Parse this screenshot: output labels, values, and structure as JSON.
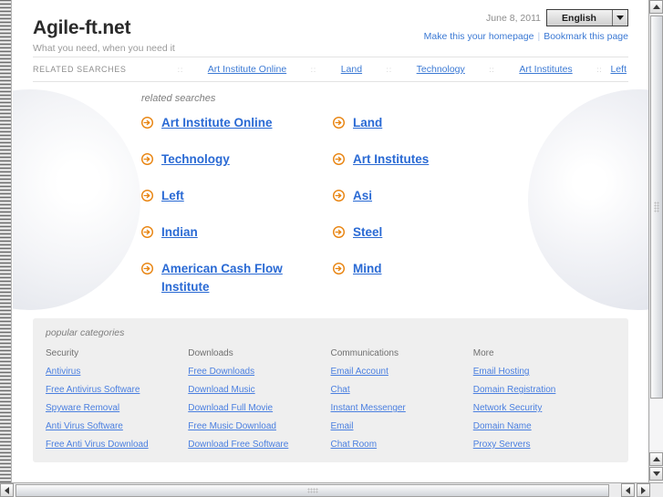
{
  "header": {
    "site_title": "Agile-ft.net",
    "tagline": "What you need, when you need it",
    "date": "June 8, 2011",
    "language": "English",
    "homepage_link": "Make this your homepage",
    "bookmark_link": "Bookmark this page",
    "separator": "|"
  },
  "related_bar": {
    "label": "RELATED SEARCHES",
    "dots": "::",
    "links": [
      "Art Institute Online",
      "Land",
      "Technology",
      "Art Institutes",
      "Left"
    ]
  },
  "main": {
    "heading": "related searches",
    "links": [
      "Art Institute Online",
      "Land",
      "Technology",
      "Art Institutes",
      "Left",
      "Asi",
      "Indian",
      "Steel",
      "American Cash Flow Institute",
      "Mind"
    ]
  },
  "categories": {
    "heading": "popular categories",
    "columns": [
      {
        "title": "Security",
        "links": [
          "Antivirus",
          "Free Antivirus Software",
          "Spyware Removal",
          "Anti Virus Software",
          "Free Anti Virus Download"
        ]
      },
      {
        "title": "Downloads",
        "links": [
          "Free Downloads",
          "Download Music",
          "Download Full Movie",
          "Free Music Download",
          "Download Free Software"
        ]
      },
      {
        "title": "Communications",
        "links": [
          "Email Account",
          "Chat",
          "Instant Messenger",
          "Email",
          "Chat Room"
        ]
      },
      {
        "title": "More",
        "links": [
          "Email Hosting",
          "Domain Registration",
          "Network Security",
          "Domain Name",
          "Proxy Servers"
        ]
      }
    ]
  },
  "colors": {
    "link_blue": "#3b79d4",
    "big_link_blue": "#2a6ad4",
    "arrow_orange": "#e8820c",
    "panel_gray": "#efefef"
  }
}
